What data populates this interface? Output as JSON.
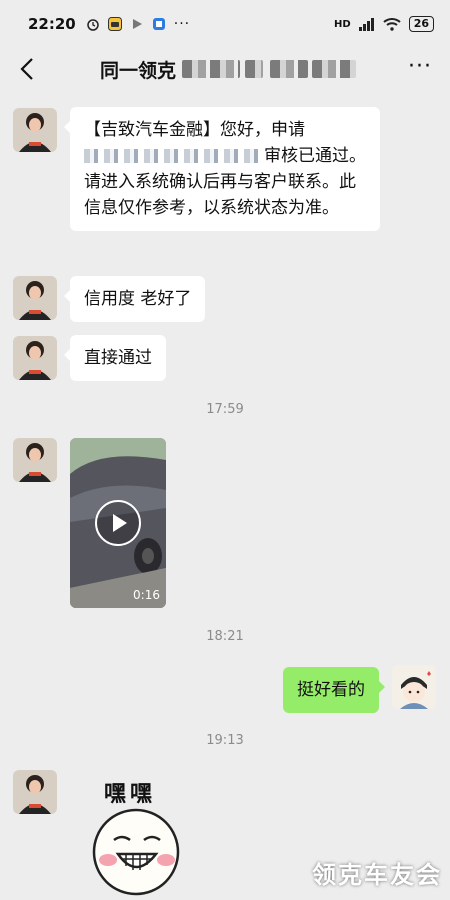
{
  "status_bar": {
    "time": "22:20",
    "signal": "HD",
    "battery": "26",
    "icons": [
      "alarm-icon",
      "app-notification-icon",
      "play-store-icon",
      "app-icon",
      "more-dots"
    ]
  },
  "nav": {
    "back_icon": "chevron-left-icon",
    "title": "同一领克",
    "more_icon": "more-horizontal-icon",
    "more_label": "···"
  },
  "messages": [
    {
      "sender": "other",
      "type": "text",
      "text_start": "【吉致汽车金融】您好，申请",
      "text_end": "审核已通过。请进入系统确认后再与客户联系。此信息仅作参考，以系统状态为准。"
    },
    {
      "sender": "other",
      "type": "text",
      "text": "信用度 老好了"
    },
    {
      "sender": "other",
      "type": "text",
      "text": "直接通过"
    },
    {
      "type": "timestamp",
      "text": "17:59"
    },
    {
      "sender": "other",
      "type": "video",
      "duration": "0:16"
    },
    {
      "type": "timestamp",
      "text": "18:21"
    },
    {
      "sender": "self",
      "type": "text",
      "text": "挺好看的"
    },
    {
      "type": "timestamp",
      "text": "19:13"
    },
    {
      "sender": "other",
      "type": "sticker",
      "caption": "嘿嘿"
    }
  ],
  "watermark": "领克车友会",
  "colors": {
    "background": "#ededed",
    "bubble_other": "#ffffff",
    "bubble_self": "#95ec69",
    "timestamp": "#8b8b8b"
  }
}
